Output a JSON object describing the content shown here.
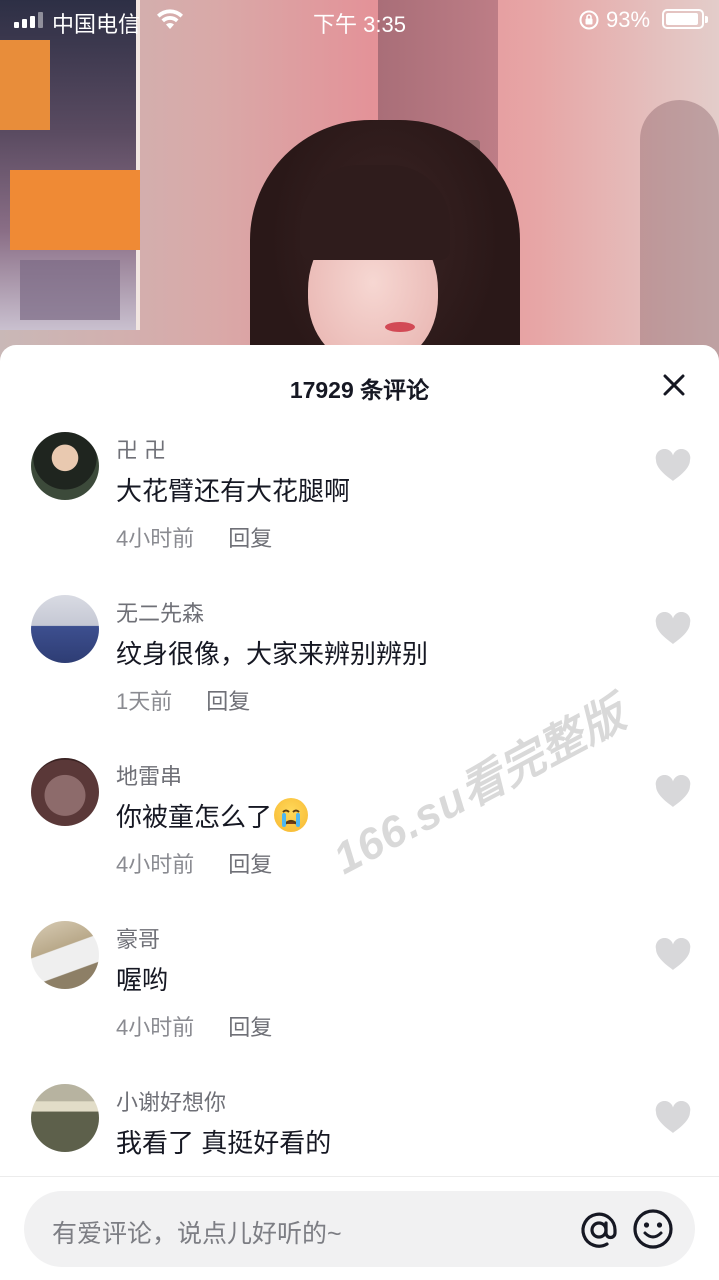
{
  "status_bar": {
    "carrier": "中国电信",
    "time": "下午 3:35",
    "battery_percent_text": "93%",
    "battery_level": 0.93
  },
  "comments_sheet": {
    "title": "17929 条评论",
    "comments": [
      {
        "username": "卍 卍",
        "text": "大花臂还有大花腿啊",
        "time": "4小时前",
        "reply": "回复",
        "avatar_color": "#2f3a2f"
      },
      {
        "username": "无二先森",
        "text": "纹身很像，大家来辨别辨别",
        "time": "1天前",
        "reply": "回复",
        "avatar_color": "#5a5f7a"
      },
      {
        "username": "地雷串",
        "text": "你被童怎么了",
        "time": "4小时前",
        "reply": "回复",
        "avatar_color": "#6b3a3a",
        "emoji": "loudly-crying-face"
      },
      {
        "username": "豪哥",
        "text": "喔哟",
        "time": "4小时前",
        "reply": "回复",
        "avatar_color": "#b9a98a"
      },
      {
        "username": "小谢好想你",
        "text": "我看了 真挺好看的",
        "time": "",
        "reply": "",
        "avatar_color": "#4b4e3e"
      }
    ]
  },
  "watermark": "166.su看完整版",
  "input_bar": {
    "placeholder": "有爱评论，说点儿好听的~"
  },
  "icons": {
    "close": "close-icon",
    "like": "heart-icon",
    "mention": "at-icon",
    "emoji": "emoji-icon"
  },
  "colors": {
    "text_primary": "#161823",
    "text_secondary": "#6f7077",
    "like_icon": "#d8d8da"
  }
}
